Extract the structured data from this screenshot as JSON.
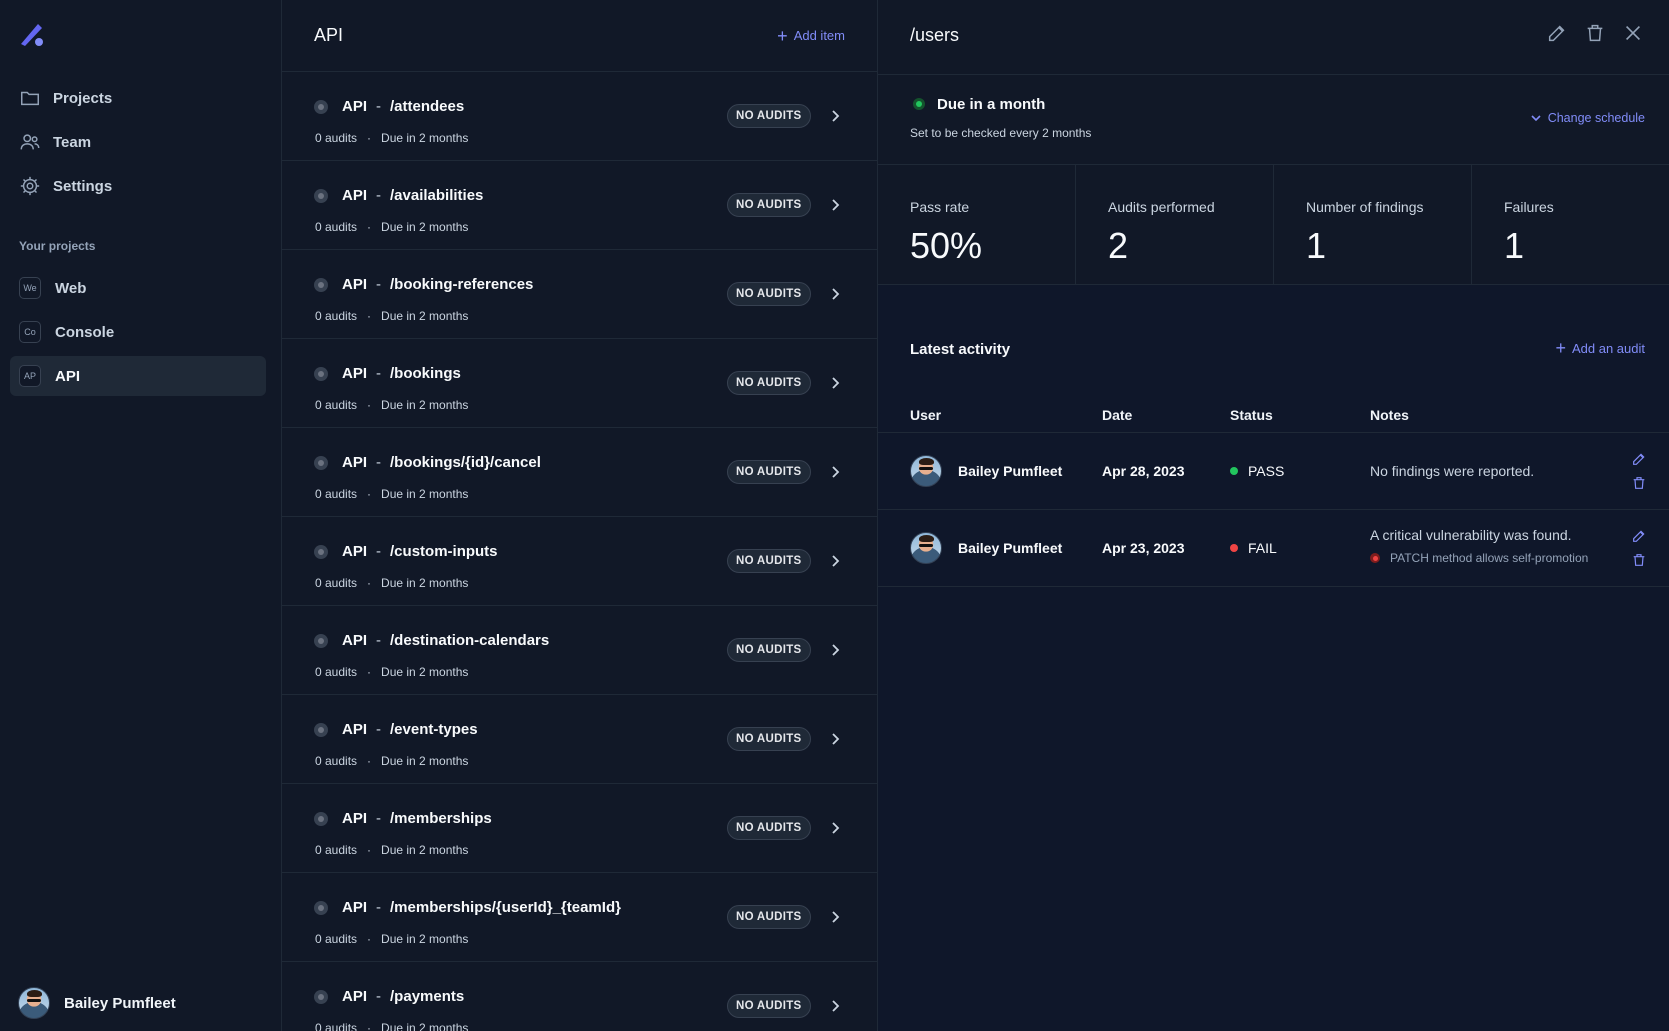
{
  "sidebar": {
    "nav": [
      {
        "label": "Projects",
        "icon": "folder-icon"
      },
      {
        "label": "Team",
        "icon": "users-icon"
      },
      {
        "label": "Settings",
        "icon": "gear-icon"
      }
    ],
    "section_title": "Your projects",
    "projects": [
      {
        "badge": "We",
        "label": "Web"
      },
      {
        "badge": "Co",
        "label": "Console"
      },
      {
        "badge": "AP",
        "label": "API",
        "active": true
      }
    ],
    "user": {
      "name": "Bailey Pumfleet"
    }
  },
  "list": {
    "title": "API",
    "add_label": "Add item",
    "badge_label": "NO AUDITS",
    "items": [
      {
        "prefix": "API",
        "path": "/attendees",
        "audits": "0 audits",
        "due": "Due in 2 months"
      },
      {
        "prefix": "API",
        "path": "/availabilities",
        "audits": "0 audits",
        "due": "Due in 2 months"
      },
      {
        "prefix": "API",
        "path": "/booking-references",
        "audits": "0 audits",
        "due": "Due in 2 months"
      },
      {
        "prefix": "API",
        "path": "/bookings",
        "audits": "0 audits",
        "due": "Due in 2 months"
      },
      {
        "prefix": "API",
        "path": "/bookings/{id}/cancel",
        "audits": "0 audits",
        "due": "Due in 2 months"
      },
      {
        "prefix": "API",
        "path": "/custom-inputs",
        "audits": "0 audits",
        "due": "Due in 2 months"
      },
      {
        "prefix": "API",
        "path": "/destination-calendars",
        "audits": "0 audits",
        "due": "Due in 2 months"
      },
      {
        "prefix": "API",
        "path": "/event-types",
        "audits": "0 audits",
        "due": "Due in 2 months"
      },
      {
        "prefix": "API",
        "path": "/memberships",
        "audits": "0 audits",
        "due": "Due in 2 months"
      },
      {
        "prefix": "API",
        "path": "/memberships/{userId}_{teamId}",
        "audits": "0 audits",
        "due": "Due in 2 months"
      },
      {
        "prefix": "API",
        "path": "/payments",
        "audits": "0 audits",
        "due": "Due in 2 months"
      }
    ]
  },
  "detail": {
    "title": "/users",
    "schedule": {
      "title": "Due in a month",
      "subtitle": "Set to be checked every 2 months",
      "change_label": "Change schedule"
    },
    "stats": [
      {
        "label": "Pass rate",
        "value": "50%"
      },
      {
        "label": "Audits performed",
        "value": "2"
      },
      {
        "label": "Number of findings",
        "value": "1"
      },
      {
        "label": "Failures",
        "value": "1"
      }
    ],
    "activity": {
      "title": "Latest activity",
      "add_label": "Add an audit",
      "columns": {
        "user": "User",
        "date": "Date",
        "status": "Status",
        "notes": "Notes"
      },
      "rows": [
        {
          "user": "Bailey Pumfleet",
          "date": "Apr 28, 2023",
          "status": "PASS",
          "status_color": "#22c55e",
          "notes": "No findings were reported.",
          "finding": ""
        },
        {
          "user": "Bailey Pumfleet",
          "date": "Apr 23, 2023",
          "status": "FAIL",
          "status_color": "#ef4444",
          "notes": "A critical vulnerability was found.",
          "finding": "PATCH method allows self-promotion"
        }
      ]
    }
  },
  "colors": {
    "accent": "#818cf8",
    "pass": "#22c55e",
    "fail": "#ef4444"
  }
}
